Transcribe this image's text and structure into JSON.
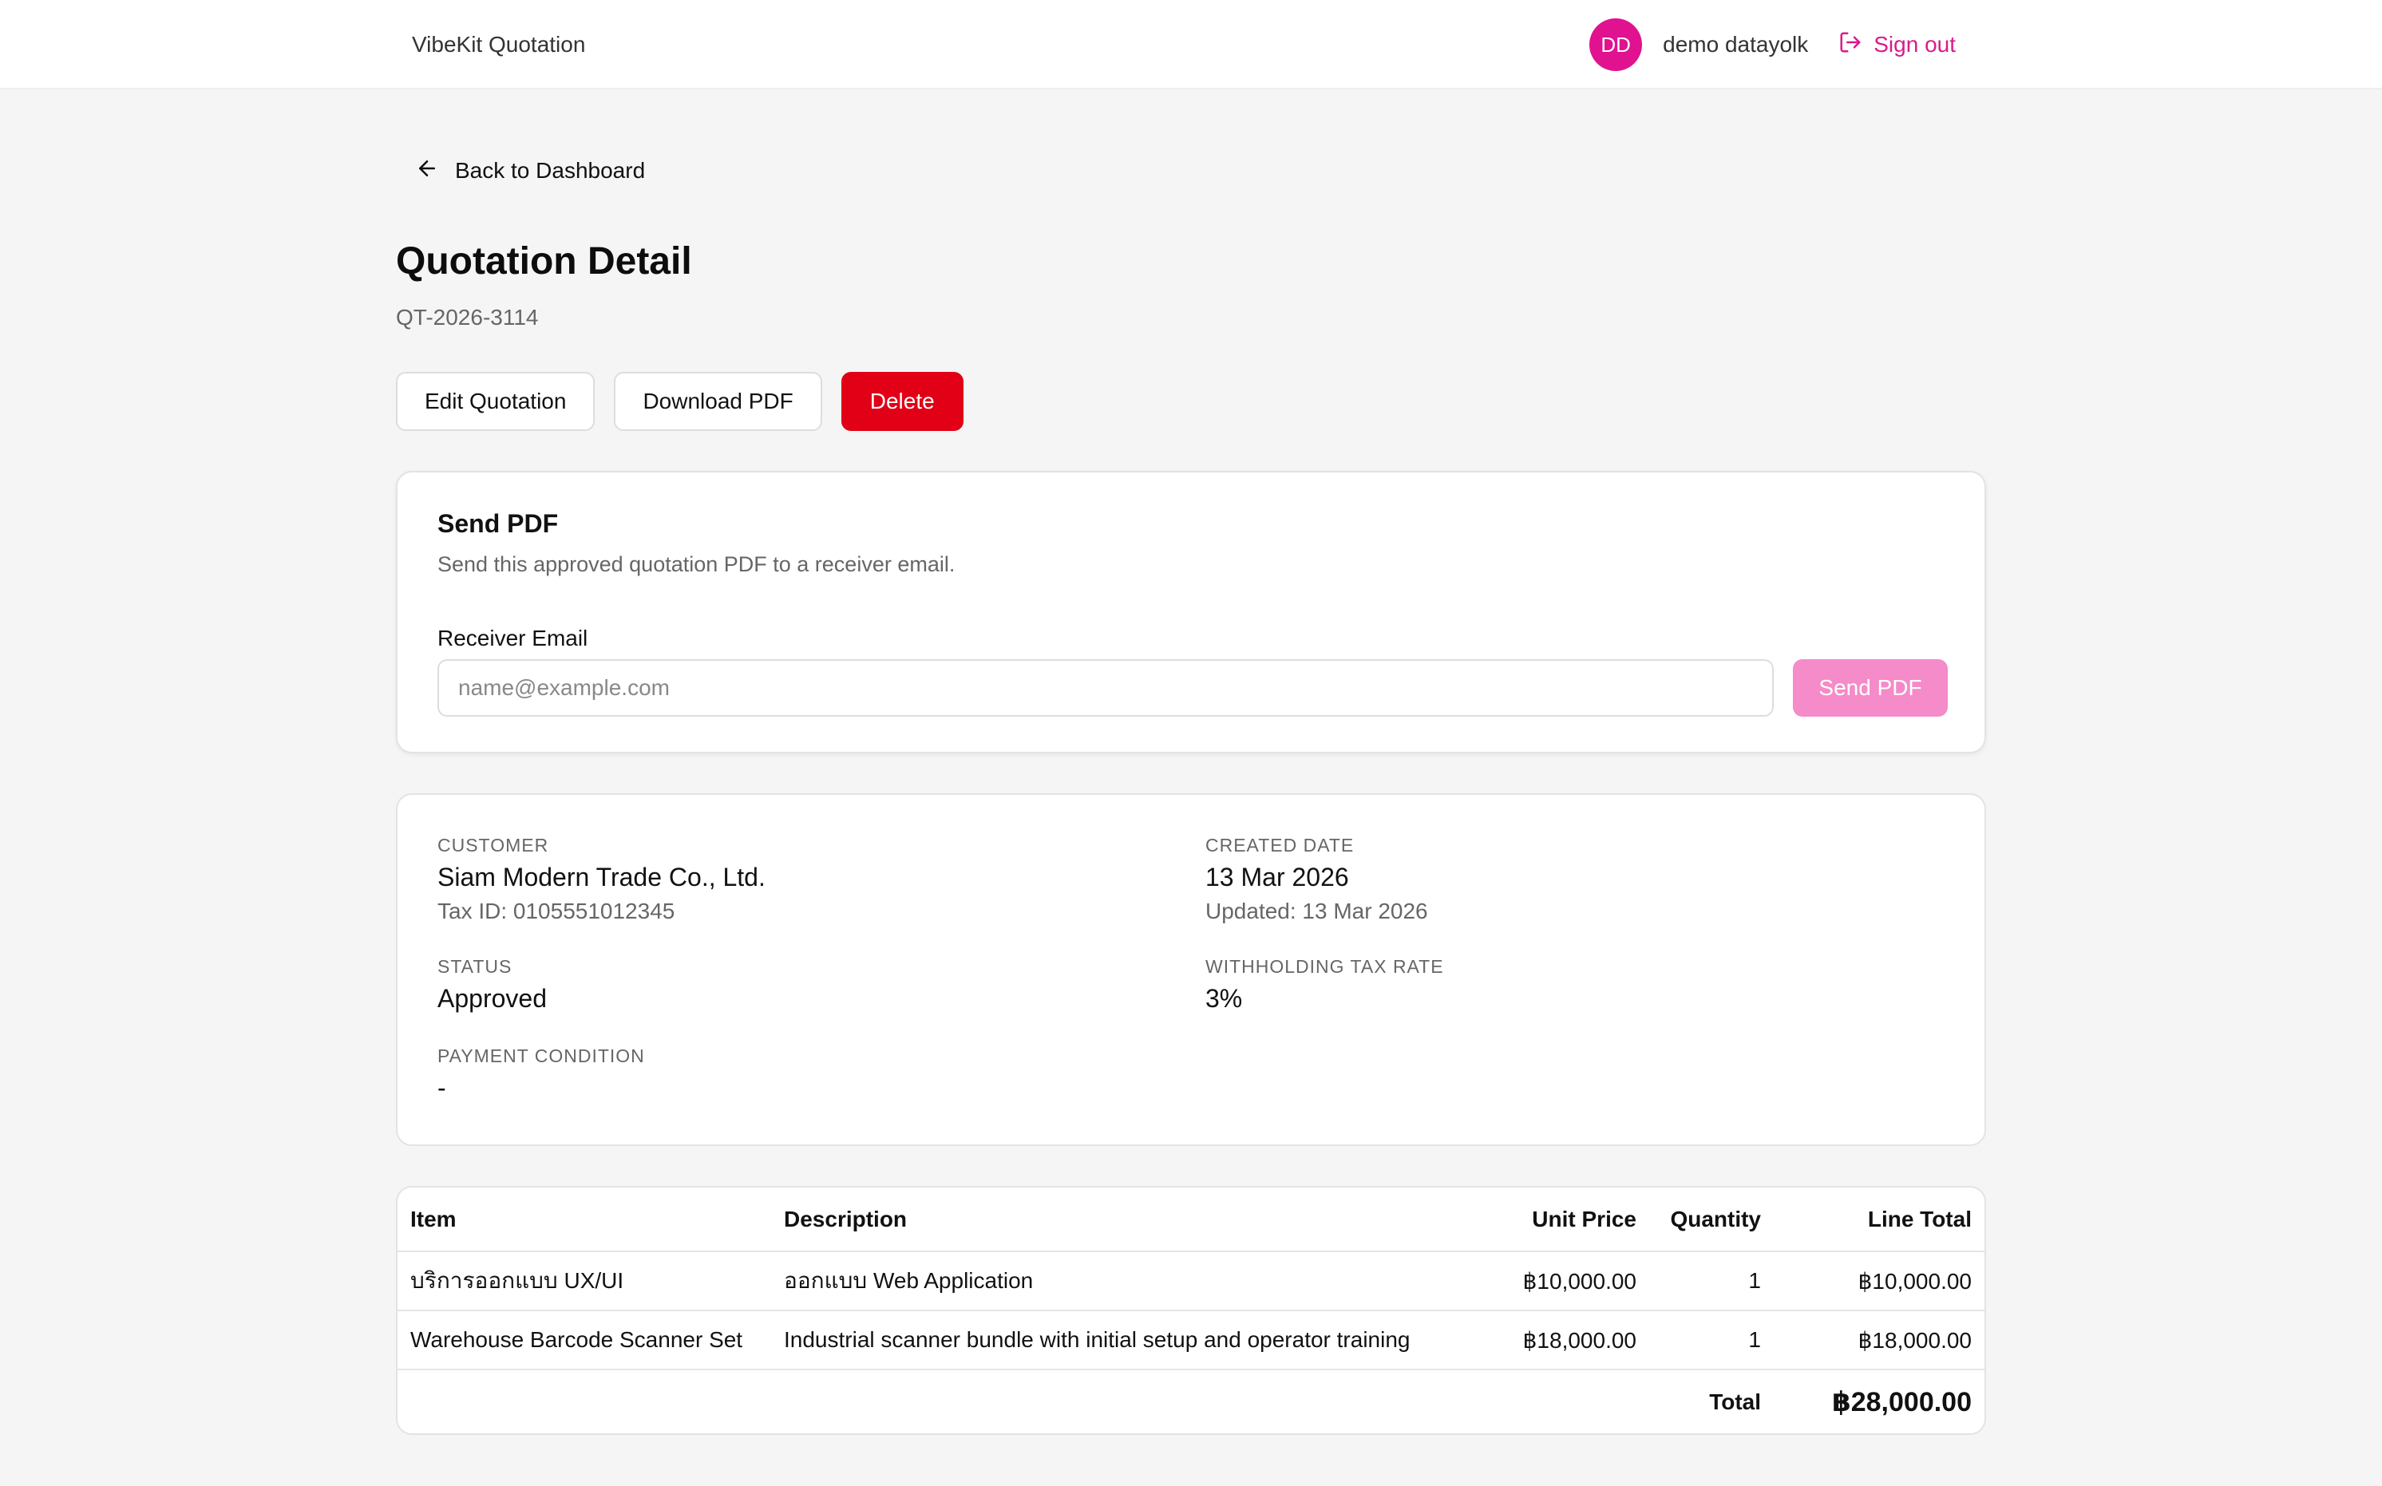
{
  "header": {
    "brand": "VibeKit Quotation",
    "avatar_initials": "DD",
    "username": "demo datayolk",
    "signout_label": "Sign out",
    "accent_color": "#e0128f"
  },
  "nav": {
    "back_label": "Back to Dashboard"
  },
  "page": {
    "title": "Quotation Detail",
    "quotation_number": "QT-2026-3114"
  },
  "actions": {
    "edit_label": "Edit Quotation",
    "download_label": "Download PDF",
    "delete_label": "Delete"
  },
  "send_pdf": {
    "title": "Send PDF",
    "subtitle": "Send this approved quotation PDF to a receiver email.",
    "email_label": "Receiver Email",
    "email_placeholder": "name@example.com",
    "email_value": "",
    "send_button": "Send PDF"
  },
  "details": {
    "customer": {
      "label": "Customer",
      "value": "Siam Modern Trade Co., Ltd.",
      "sub": "Tax ID: 0105551012345"
    },
    "created_date": {
      "label": "Created Date",
      "value": "13 Mar 2026",
      "sub": "Updated: 13 Mar 2026"
    },
    "status": {
      "label": "Status",
      "value": "Approved"
    },
    "withholding_tax": {
      "label": "Withholding Tax Rate",
      "value": "3%"
    },
    "payment_condition": {
      "label": "Payment Condition",
      "value": "-"
    }
  },
  "items_table": {
    "headers": {
      "item": "Item",
      "description": "Description",
      "unit_price": "Unit Price",
      "quantity": "Quantity",
      "line_total": "Line Total"
    },
    "rows": [
      {
        "item": "บริการออกแบบ UX/UI",
        "description": "ออกแบบ Web Application",
        "unit_price": "฿10,000.00",
        "quantity": "1",
        "line_total": "฿10,000.00"
      },
      {
        "item": "Warehouse Barcode Scanner Set",
        "description": "Industrial scanner bundle with initial setup and operator training",
        "unit_price": "฿18,000.00",
        "quantity": "1",
        "line_total": "฿18,000.00"
      }
    ],
    "total_label": "Total",
    "total_value": "฿28,000.00"
  }
}
